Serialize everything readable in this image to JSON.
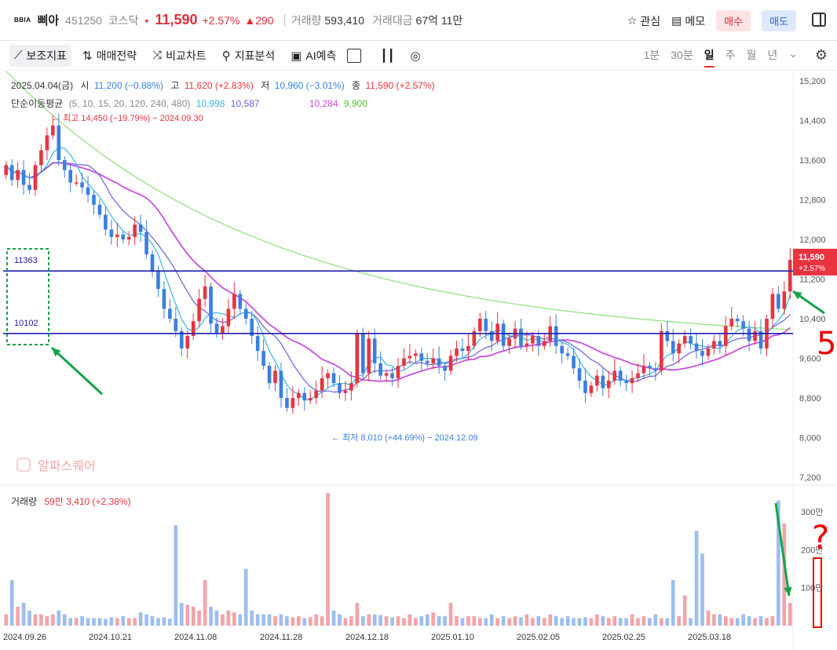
{
  "header": {
    "logo": "BBIA",
    "name": "삐아",
    "code": "451250",
    "market": "코스닥",
    "price": "11,590",
    "change_pct": "+2.57%",
    "change_abs": "▲290",
    "volume_label": "거래량",
    "volume": "593,410",
    "amount_label": "거래대금",
    "amount": "67억 11만",
    "fav": "관심",
    "memo": "메모",
    "buy": "매수",
    "sell": "매도"
  },
  "toolbar": {
    "items": [
      "보조지표",
      "매매전략",
      "비교차트",
      "지표분석",
      "AI예측"
    ],
    "periods": [
      "1분",
      "30분",
      "일",
      "주",
      "월",
      "년"
    ],
    "active_period": "일"
  },
  "colors": {
    "up": "#e8343f",
    "down": "#3a7fe0",
    "ma5": "#37b6e8",
    "ma10": "#6a5ee0",
    "ma20": "#c94ee0",
    "ma120": "#8ee07a"
  },
  "chart_data": {
    "type": "candlestick",
    "info_line": {
      "date": "2025.04.04(금)",
      "open_label": "시",
      "open": "11,200 (−0.88%)",
      "high_label": "고",
      "high": "11,620 (+2.83%)",
      "low_label": "저",
      "low": "10,960 (−3.01%)",
      "close_label": "종",
      "close": "11,590 (+2.57%)"
    },
    "ma_line": {
      "label": "단순이동평균",
      "periods": "(5, 10, 15, 20, 120, 240, 480)",
      "ma5": "10,998",
      "ma10": "10,587",
      "ma20": "10,284",
      "ma120": "9,900"
    },
    "high_annotation": "최고 14,450 (−19.79%) − 2024.09.30",
    "low_annotation": "최저 8,010 (+44.69%) − 2024.12.09",
    "hlines": [
      {
        "label": "11363",
        "value": 11363
      },
      {
        "label": "10102",
        "value": 10102
      }
    ],
    "last_price_tag": {
      "price": "11,590",
      "change": "+2.57%",
      "value": 11590
    },
    "watermark": "알파스퀘어",
    "y_ticks": [
      "15,200",
      "14,400",
      "13,600",
      "12,800",
      "12,000",
      "11,200",
      "10,400",
      "9,600",
      "8,800",
      "8,000",
      "7,200"
    ],
    "y_min": 7200,
    "y_max": 15200,
    "volume_label": "거래량",
    "volume_value": "59만 3,410 (+2.38%)",
    "volume_ticks": [
      "300만",
      "200만",
      "100만"
    ],
    "x_ticks": [
      "2024.09.26",
      "2024.10.21",
      "2024.11.08",
      "2024.11.28",
      "2024.12.18",
      "2025.01.10",
      "2025.02.05",
      "2025.02.25",
      "2025.03.18"
    ],
    "annotation_text": "5",
    "annotation_mark": "?",
    "closes": [
      13500,
      13200,
      13400,
      13100,
      13000,
      13500,
      13800,
      14100,
      14300,
      13600,
      13400,
      13150,
      13150,
      13050,
      12900,
      12700,
      12500,
      12200,
      12050,
      12100,
      12000,
      12050,
      12300,
      12150,
      11700,
      11350,
      11000,
      10600,
      10400,
      10150,
      9800,
      10050,
      10350,
      10800,
      11050,
      10300,
      10100,
      10250,
      10600,
      10900,
      10600,
      10400,
      10050,
      9750,
      9450,
      9100,
      9350,
      8800,
      8600,
      8800,
      8900,
      8750,
      8800,
      8950,
      9200,
      9300,
      9100,
      8900,
      8950,
      9100,
      10100,
      9300,
      10000,
      9500,
      9250,
      9300,
      9200,
      9450,
      9600,
      9650,
      9700,
      9550,
      9500,
      9600,
      9450,
      9350,
      9650,
      9800,
      9750,
      9850,
      10150,
      10400,
      10150,
      9950,
      10300,
      9850,
      10000,
      10200,
      9850,
      9900,
      10050,
      9850,
      9950,
      10250,
      9850,
      9700,
      9650,
      9400,
      9150,
      8900,
      9050,
      9250,
      9000,
      9150,
      9350,
      9150,
      9100,
      9200,
      9300,
      9450,
      9400,
      9350,
      10150,
      9950,
      9700,
      9900,
      10050,
      9900,
      9750,
      9650,
      9800,
      9950,
      9850,
      10250,
      10400,
      10350,
      10200,
      9950,
      10150,
      9800,
      10400,
      10900,
      10600,
      10950,
      11590
    ],
    "volumes": [
      30,
      120,
      50,
      60,
      40,
      30,
      30,
      25,
      30,
      40,
      30,
      20,
      20,
      25,
      20,
      20,
      20,
      18,
      22,
      20,
      25,
      20,
      20,
      35,
      30,
      25,
      20,
      22,
      18,
      265,
      60,
      55,
      50,
      40,
      120,
      50,
      40,
      30,
      40,
      35,
      30,
      150,
      40,
      30,
      30,
      30,
      25,
      30,
      25,
      22,
      25,
      20,
      22,
      30,
      25,
      350,
      40,
      30,
      20,
      25,
      60,
      25,
      30,
      30,
      28,
      25,
      22,
      25,
      20,
      30,
      20,
      25,
      30,
      35,
      25,
      25,
      60,
      25,
      20,
      25,
      25,
      20,
      20,
      30,
      20,
      25,
      20,
      25,
      22,
      30,
      20,
      25,
      20,
      30,
      25,
      20,
      25,
      20,
      20,
      22,
      20,
      30,
      25,
      20,
      25,
      20,
      20,
      30,
      20,
      25,
      20,
      30,
      20,
      20,
      120,
      25,
      80,
      20,
      250,
      190,
      40,
      30,
      30,
      25,
      20,
      20,
      30,
      25,
      20,
      25,
      20,
      25,
      330,
      270,
      60
    ]
  }
}
